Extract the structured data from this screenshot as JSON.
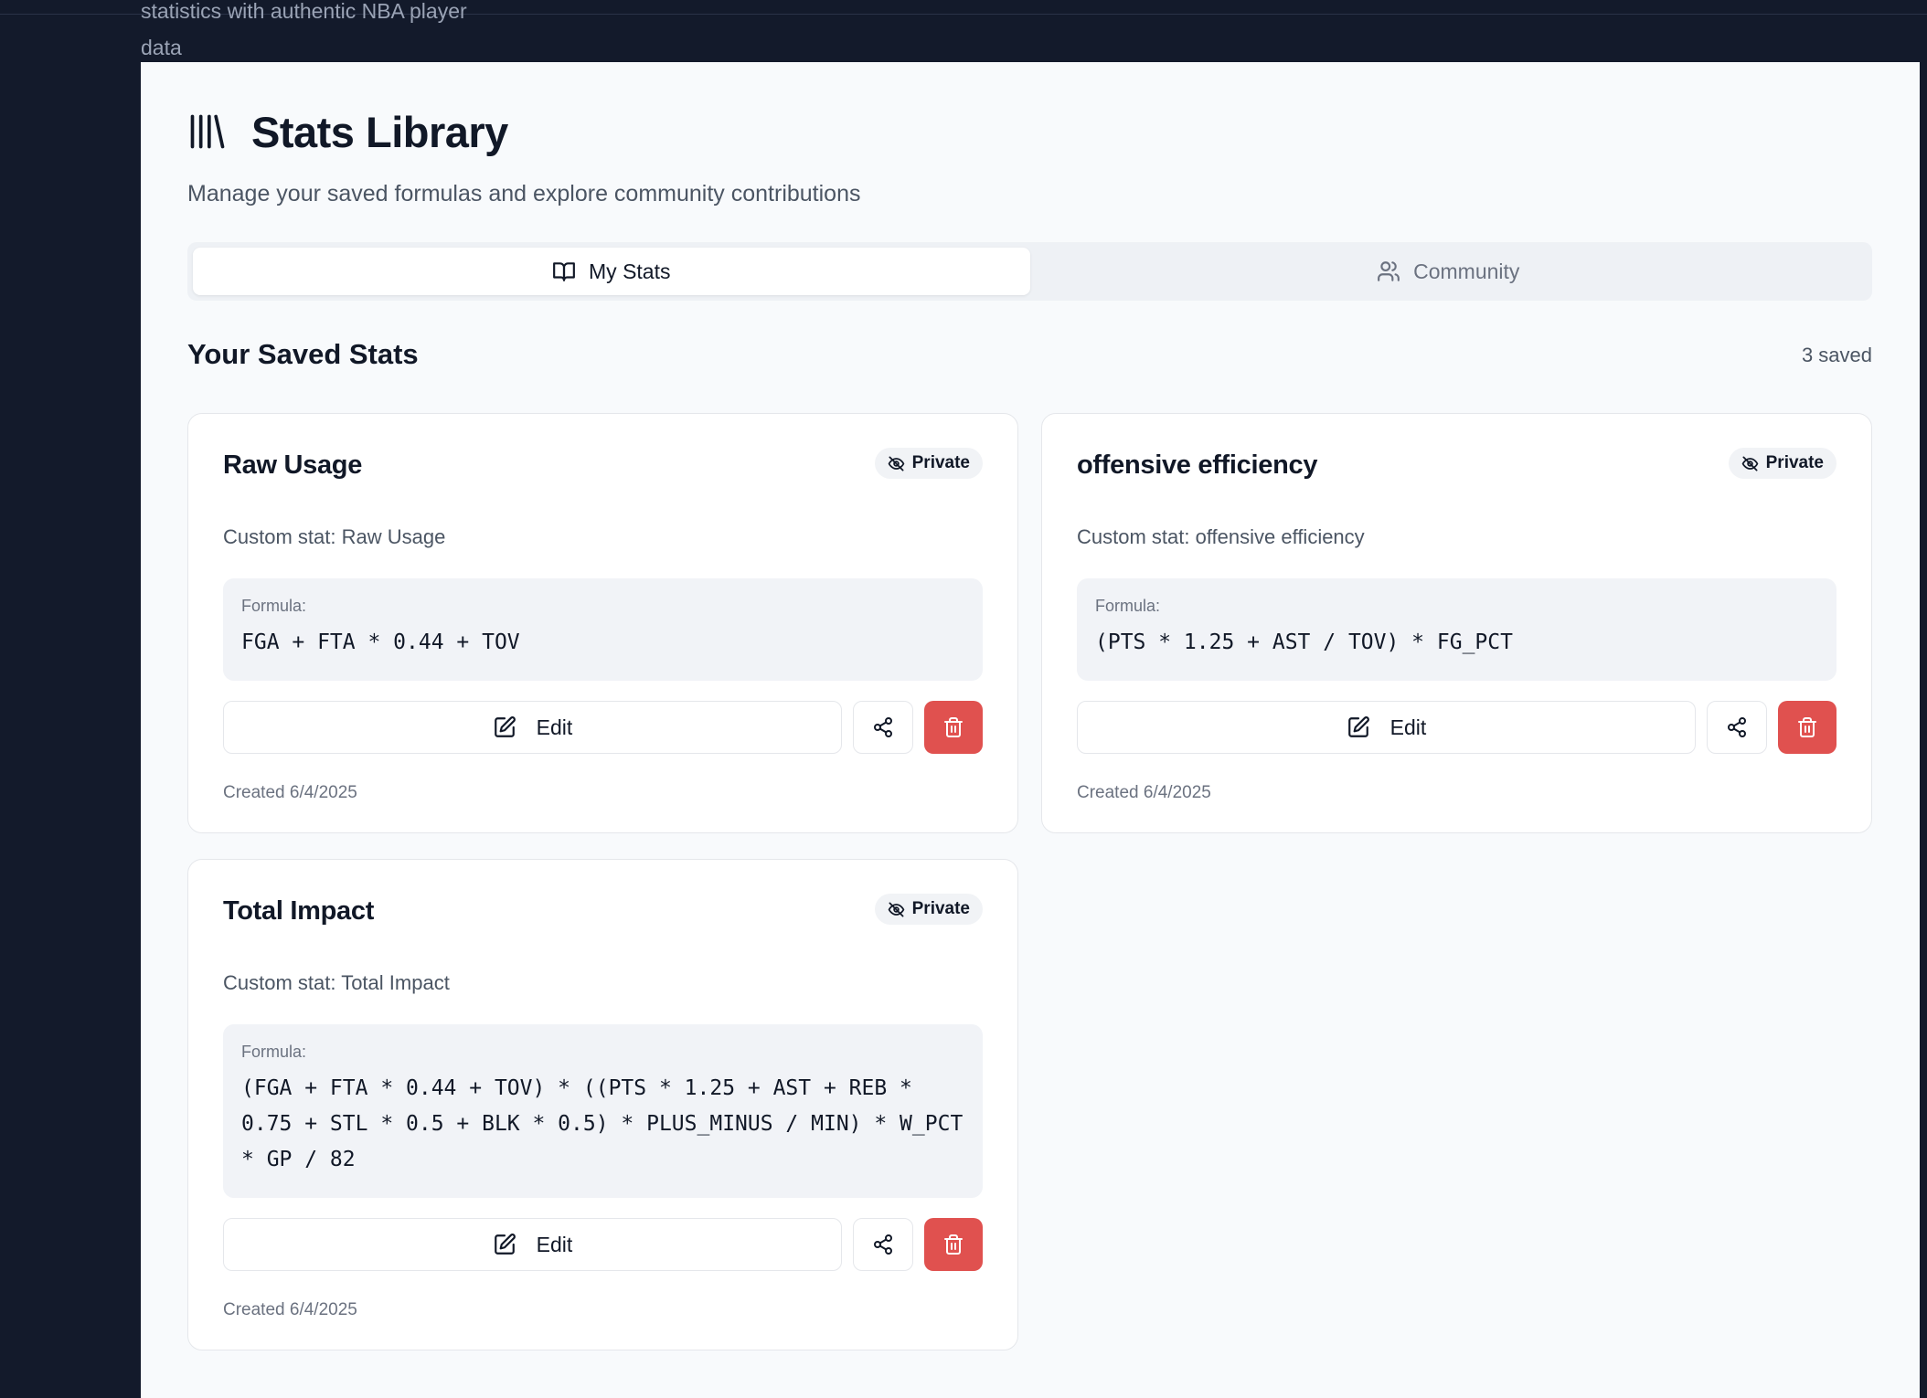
{
  "tagline": "statistics with authentic NBA player data",
  "header": {
    "icon": "library-icon",
    "title": "Stats Library",
    "subtitle": "Manage your saved formulas and explore community contributions"
  },
  "tabs": [
    {
      "label": "My Stats",
      "icon": "book-open-icon",
      "active": true
    },
    {
      "label": "Community",
      "icon": "users-icon",
      "active": false
    }
  ],
  "section": {
    "title": "Your Saved Stats",
    "count": "3 saved"
  },
  "colors": {
    "sidebar_bg": "#131a2b",
    "page_bg": "#f8fafc",
    "delete_red": "#e0514f"
  },
  "cards": [
    {
      "title": "Raw Usage",
      "badge": "Private",
      "description": "Custom stat: Raw Usage",
      "formula_label": "Formula:",
      "formula": "FGA + FTA * 0.44 + TOV",
      "edit_label": "Edit",
      "created": "Created 6/4/2025"
    },
    {
      "title": "offensive efficiency",
      "badge": "Private",
      "description": "Custom stat: offensive efficiency",
      "formula_label": "Formula:",
      "formula": "(PTS * 1.25 + AST / TOV) * FG_PCT",
      "edit_label": "Edit",
      "created": "Created 6/4/2025"
    },
    {
      "title": "Total Impact",
      "badge": "Private",
      "description": "Custom stat: Total Impact",
      "formula_label": "Formula:",
      "formula": "(FGA + FTA * 0.44 + TOV) * ((PTS * 1.25 + AST + REB * 0.75 + STL * 0.5 + BLK * 0.5) * PLUS_MINUS / MIN) * W_PCT * GP / 82",
      "edit_label": "Edit",
      "created": "Created 6/4/2025"
    }
  ]
}
